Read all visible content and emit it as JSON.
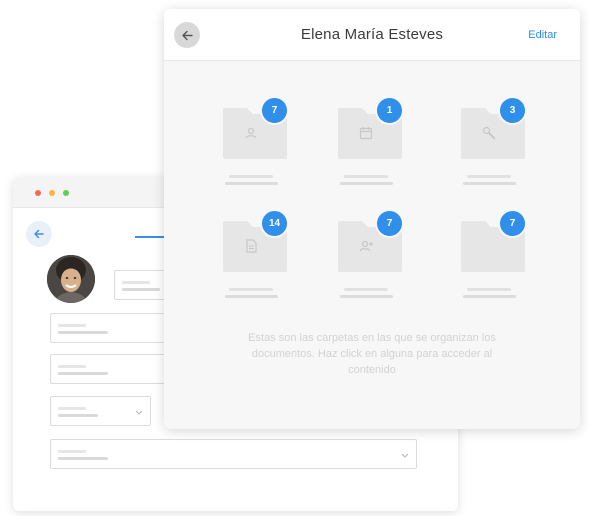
{
  "back_window": {
    "avatar_alt": "user avatar"
  },
  "panel": {
    "title": "Elena María Esteves",
    "edit_label": "Editar",
    "helper_text": "Estas son las carpetas en las que se organizan los documentos. Haz click en alguna para acceder al contenido",
    "accent_color": "#2f8fea",
    "folders": [
      {
        "icon": "user-icon",
        "count": "7"
      },
      {
        "icon": "calendar-icon",
        "count": "1"
      },
      {
        "icon": "wrench-icon",
        "count": "3"
      },
      {
        "icon": "document-icon",
        "count": "14"
      },
      {
        "icon": "user-add-icon",
        "count": "7"
      },
      {
        "icon": "blank-icon",
        "count": "7"
      }
    ]
  }
}
